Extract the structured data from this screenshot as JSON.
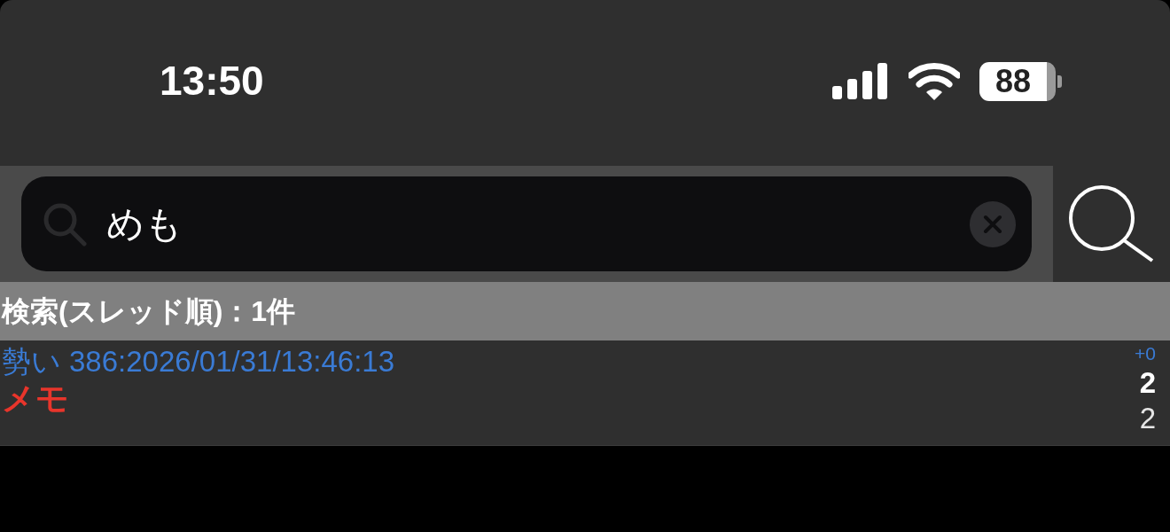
{
  "status_bar": {
    "time": "13:50",
    "battery": "88"
  },
  "search": {
    "value": "めも"
  },
  "results_header": "検索(スレッド順)：1件",
  "results": [
    {
      "momentum_label": "勢い",
      "info": "386:2026/01/31/13:46:13",
      "title": "メモ",
      "delta": "+0",
      "count": "2",
      "count_secondary": "2"
    }
  ]
}
